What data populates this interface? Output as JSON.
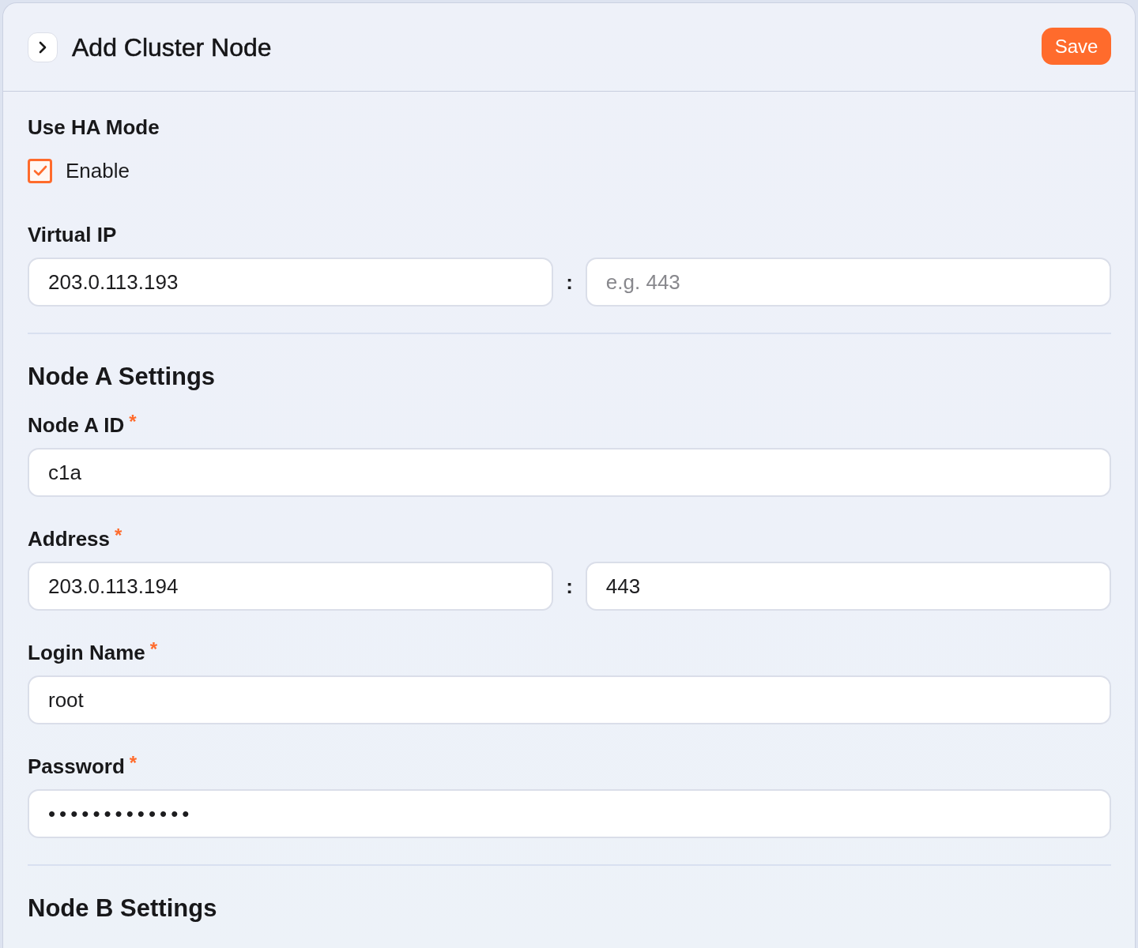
{
  "header": {
    "title": "Add Cluster Node",
    "save_label": "Save"
  },
  "groups": [
    {
      "kind": "checkbox",
      "label": "Use HA Mode",
      "option": {
        "label": "Enable",
        "checked": true
      }
    },
    {
      "kind": "host_port",
      "label": "Virtual IP",
      "host": {
        "value": "203.0.113.193"
      },
      "separator": ":",
      "port": {
        "placeholder": "e.g. 443"
      }
    }
  ],
  "sections": [
    {
      "title": "Node A Settings",
      "fields": [
        {
          "kind": "text",
          "label": "Node A ID",
          "required_mark": "*",
          "value": "c1a"
        },
        {
          "kind": "host_port",
          "label": "Address",
          "required_mark": "*",
          "host": {
            "value": "203.0.113.194"
          },
          "separator": ":",
          "port": {
            "value": "443"
          }
        },
        {
          "kind": "text",
          "label": "Login Name",
          "required_mark": "*",
          "value": "root"
        },
        {
          "kind": "password",
          "label": "Password",
          "required_mark": "*",
          "value": "•••••••••••••"
        }
      ]
    },
    {
      "title": "Node B Settings"
    }
  ]
}
